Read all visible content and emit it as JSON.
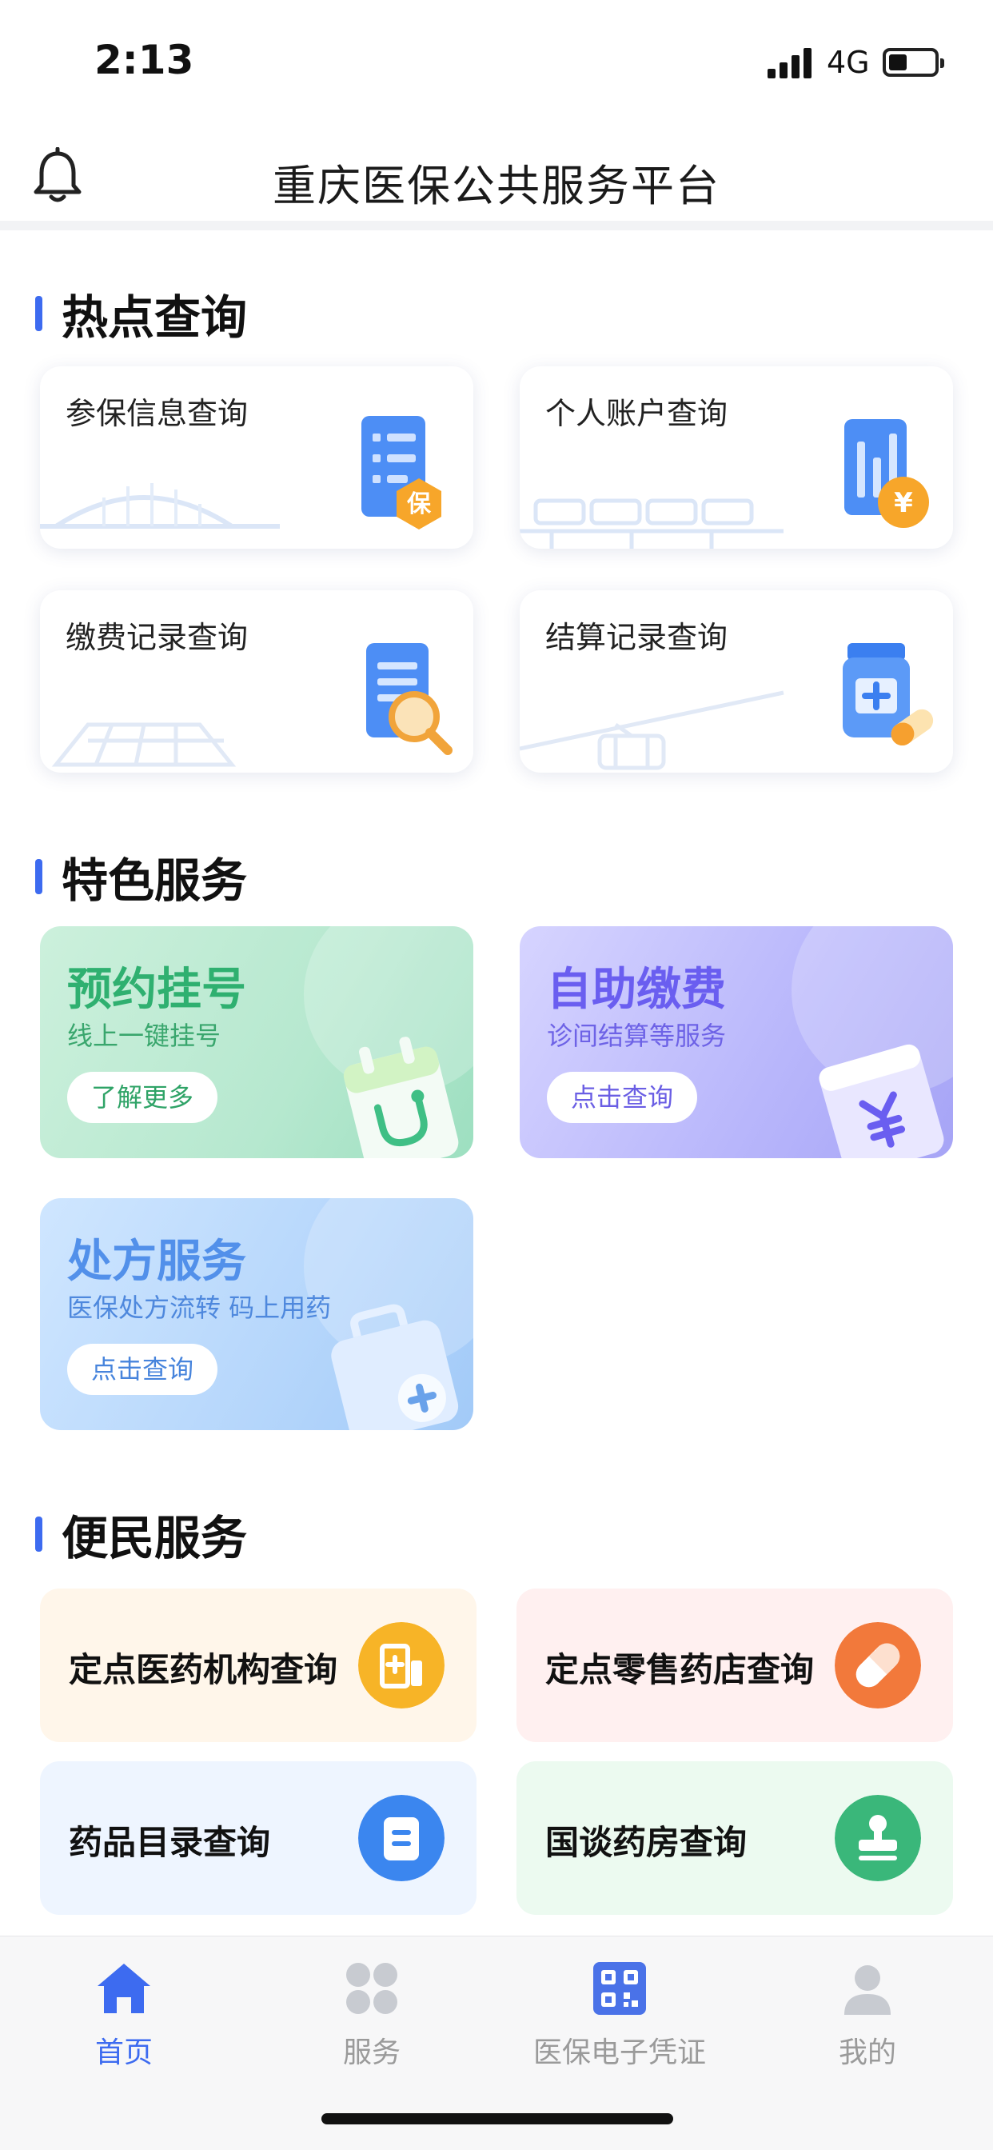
{
  "status_bar": {
    "time": "2:13",
    "network": "4G"
  },
  "header": {
    "title": "重庆医保公共服务平台",
    "bell_icon": "bell-icon"
  },
  "hot_query": {
    "title": "热点查询",
    "items": [
      {
        "label": "参保信息查询",
        "icon": "insurance-info-icon"
      },
      {
        "label": "个人账户查询",
        "icon": "account-yuan-icon"
      },
      {
        "label": "缴费记录查询",
        "icon": "payment-search-icon"
      },
      {
        "label": "结算记录查询",
        "icon": "medicine-bottle-icon"
      }
    ]
  },
  "featured": {
    "title": "特色服务",
    "items": [
      {
        "title": "预约挂号",
        "subtitle": "线上一键挂号",
        "button": "了解更多",
        "icon": "stethoscope-calendar-icon"
      },
      {
        "title": "自助缴费",
        "subtitle": "诊间结算等服务",
        "button": "点击查询",
        "icon": "yuan-wallet-icon"
      },
      {
        "title": "处方服务",
        "subtitle": "医保处方流转 码上用药",
        "button": "点击查询",
        "icon": "medical-kit-icon"
      }
    ]
  },
  "convenience": {
    "title": "便民服务",
    "items": [
      {
        "label": "定点医药机构查询",
        "icon": "hospital-icon",
        "color": "#f7b427"
      },
      {
        "label": "定点零售药店查询",
        "icon": "pill-icon",
        "color": "#f2793b"
      },
      {
        "label": "药品目录查询",
        "icon": "catalog-icon",
        "color": "#3b86ef"
      },
      {
        "label": "国谈药房查询",
        "icon": "stamp-icon",
        "color": "#3ab77a"
      }
    ]
  },
  "tabbar": {
    "items": [
      {
        "label": "首页",
        "icon": "home-icon",
        "active": true
      },
      {
        "label": "服务",
        "icon": "grid-icon",
        "active": false
      },
      {
        "label": "医保电子凭证",
        "icon": "qr-code-icon",
        "active": false
      },
      {
        "label": "我的",
        "icon": "user-icon",
        "active": false
      }
    ]
  },
  "colors": {
    "accent": "#3d6bf0",
    "inactive": "#9a9a9a"
  }
}
